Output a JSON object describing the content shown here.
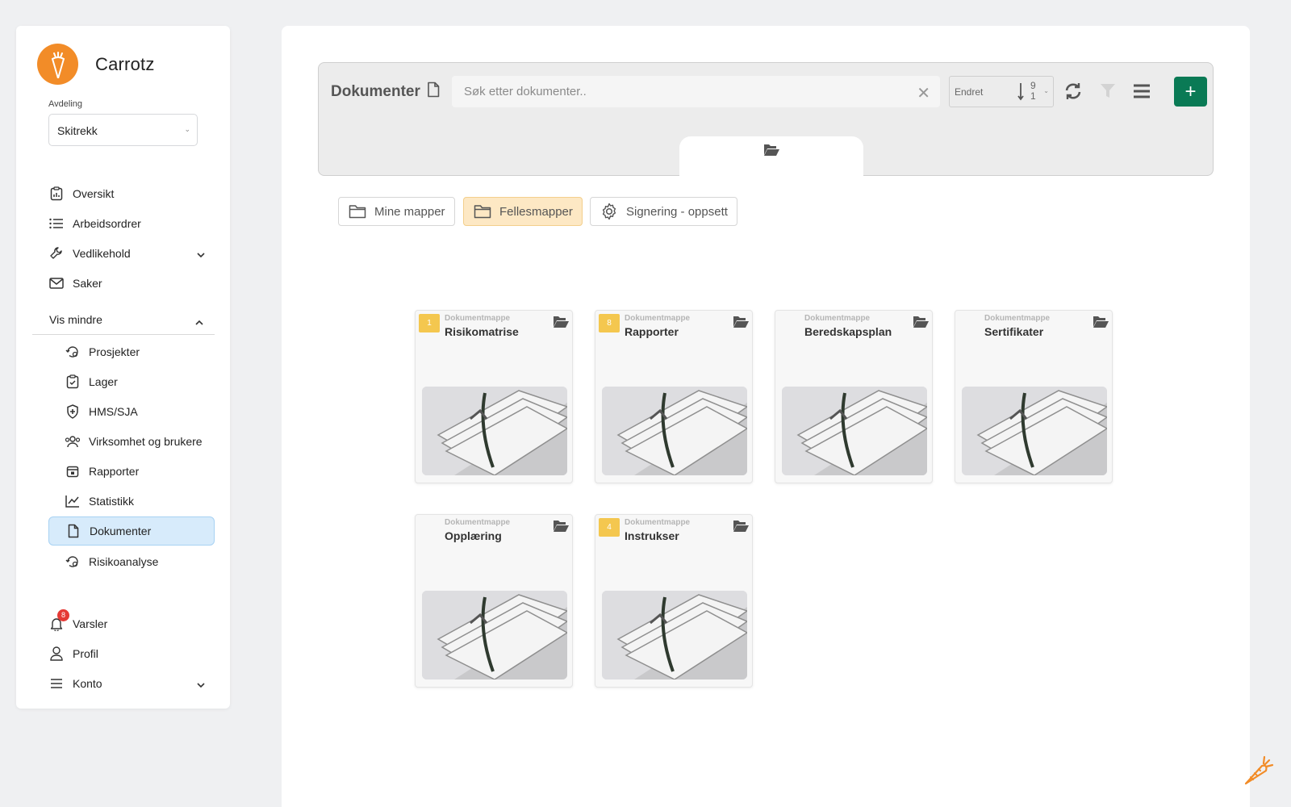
{
  "brand": {
    "name": "Carrotz",
    "color": "#f28c28"
  },
  "department": {
    "label": "Avdeling",
    "value": "Skitrekk"
  },
  "nav": {
    "items": [
      {
        "label": "Oversikt",
        "icon": "clipboard-chart-icon"
      },
      {
        "label": "Arbeidsordrer",
        "icon": "list-icon"
      },
      {
        "label": "Vedlikehold",
        "icon": "wrench-icon"
      },
      {
        "label": "Saker",
        "icon": "envelope-icon"
      }
    ],
    "vis_mindre": "Vis mindre",
    "sub_items": [
      {
        "label": "Prosjekter",
        "icon": "history-gear-icon"
      },
      {
        "label": "Lager",
        "icon": "clipboard-check-icon"
      },
      {
        "label": "HMS/SJA",
        "icon": "shield-icon"
      },
      {
        "label": "Virksomhet og brukere",
        "icon": "users-icon"
      },
      {
        "label": "Rapporter",
        "icon": "calendar-box-icon"
      },
      {
        "label": "Statistikk",
        "icon": "line-chart-icon"
      },
      {
        "label": "Dokumenter",
        "icon": "file-icon"
      },
      {
        "label": "Risikoanalyse",
        "icon": "history-gear-icon"
      }
    ],
    "bottom": [
      {
        "label": "Varsler",
        "icon": "bell-icon",
        "badge": "8"
      },
      {
        "label": "Profil",
        "icon": "user-icon"
      },
      {
        "label": "Konto",
        "icon": "menu-icon"
      }
    ]
  },
  "toolbar": {
    "title": "Dokumenter",
    "search_placeholder": "Søk etter dokumenter..",
    "clear": "✕",
    "sort_label": "Endret",
    "sort_top": "9",
    "sort_bottom": "1",
    "add_label": "+",
    "accent": "#0a7a55"
  },
  "tabs": [
    {
      "label": "Mine mapper"
    },
    {
      "label": "Fellesmapper"
    },
    {
      "label": "Signering - oppsett"
    }
  ],
  "folders": [
    {
      "kind": "Dokumentmappe",
      "name": "Risikomatrise",
      "count": "1"
    },
    {
      "kind": "Dokumentmappe",
      "name": "Rapporter",
      "count": "8"
    },
    {
      "kind": "Dokumentmappe",
      "name": "Beredskapsplan",
      "count": ""
    },
    {
      "kind": "Dokumentmappe",
      "name": "Sertifikater",
      "count": ""
    },
    {
      "kind": "Dokumentmappe",
      "name": "Opplæring",
      "count": ""
    },
    {
      "kind": "Dokumentmappe",
      "name": "Instrukser",
      "count": "4"
    }
  ]
}
